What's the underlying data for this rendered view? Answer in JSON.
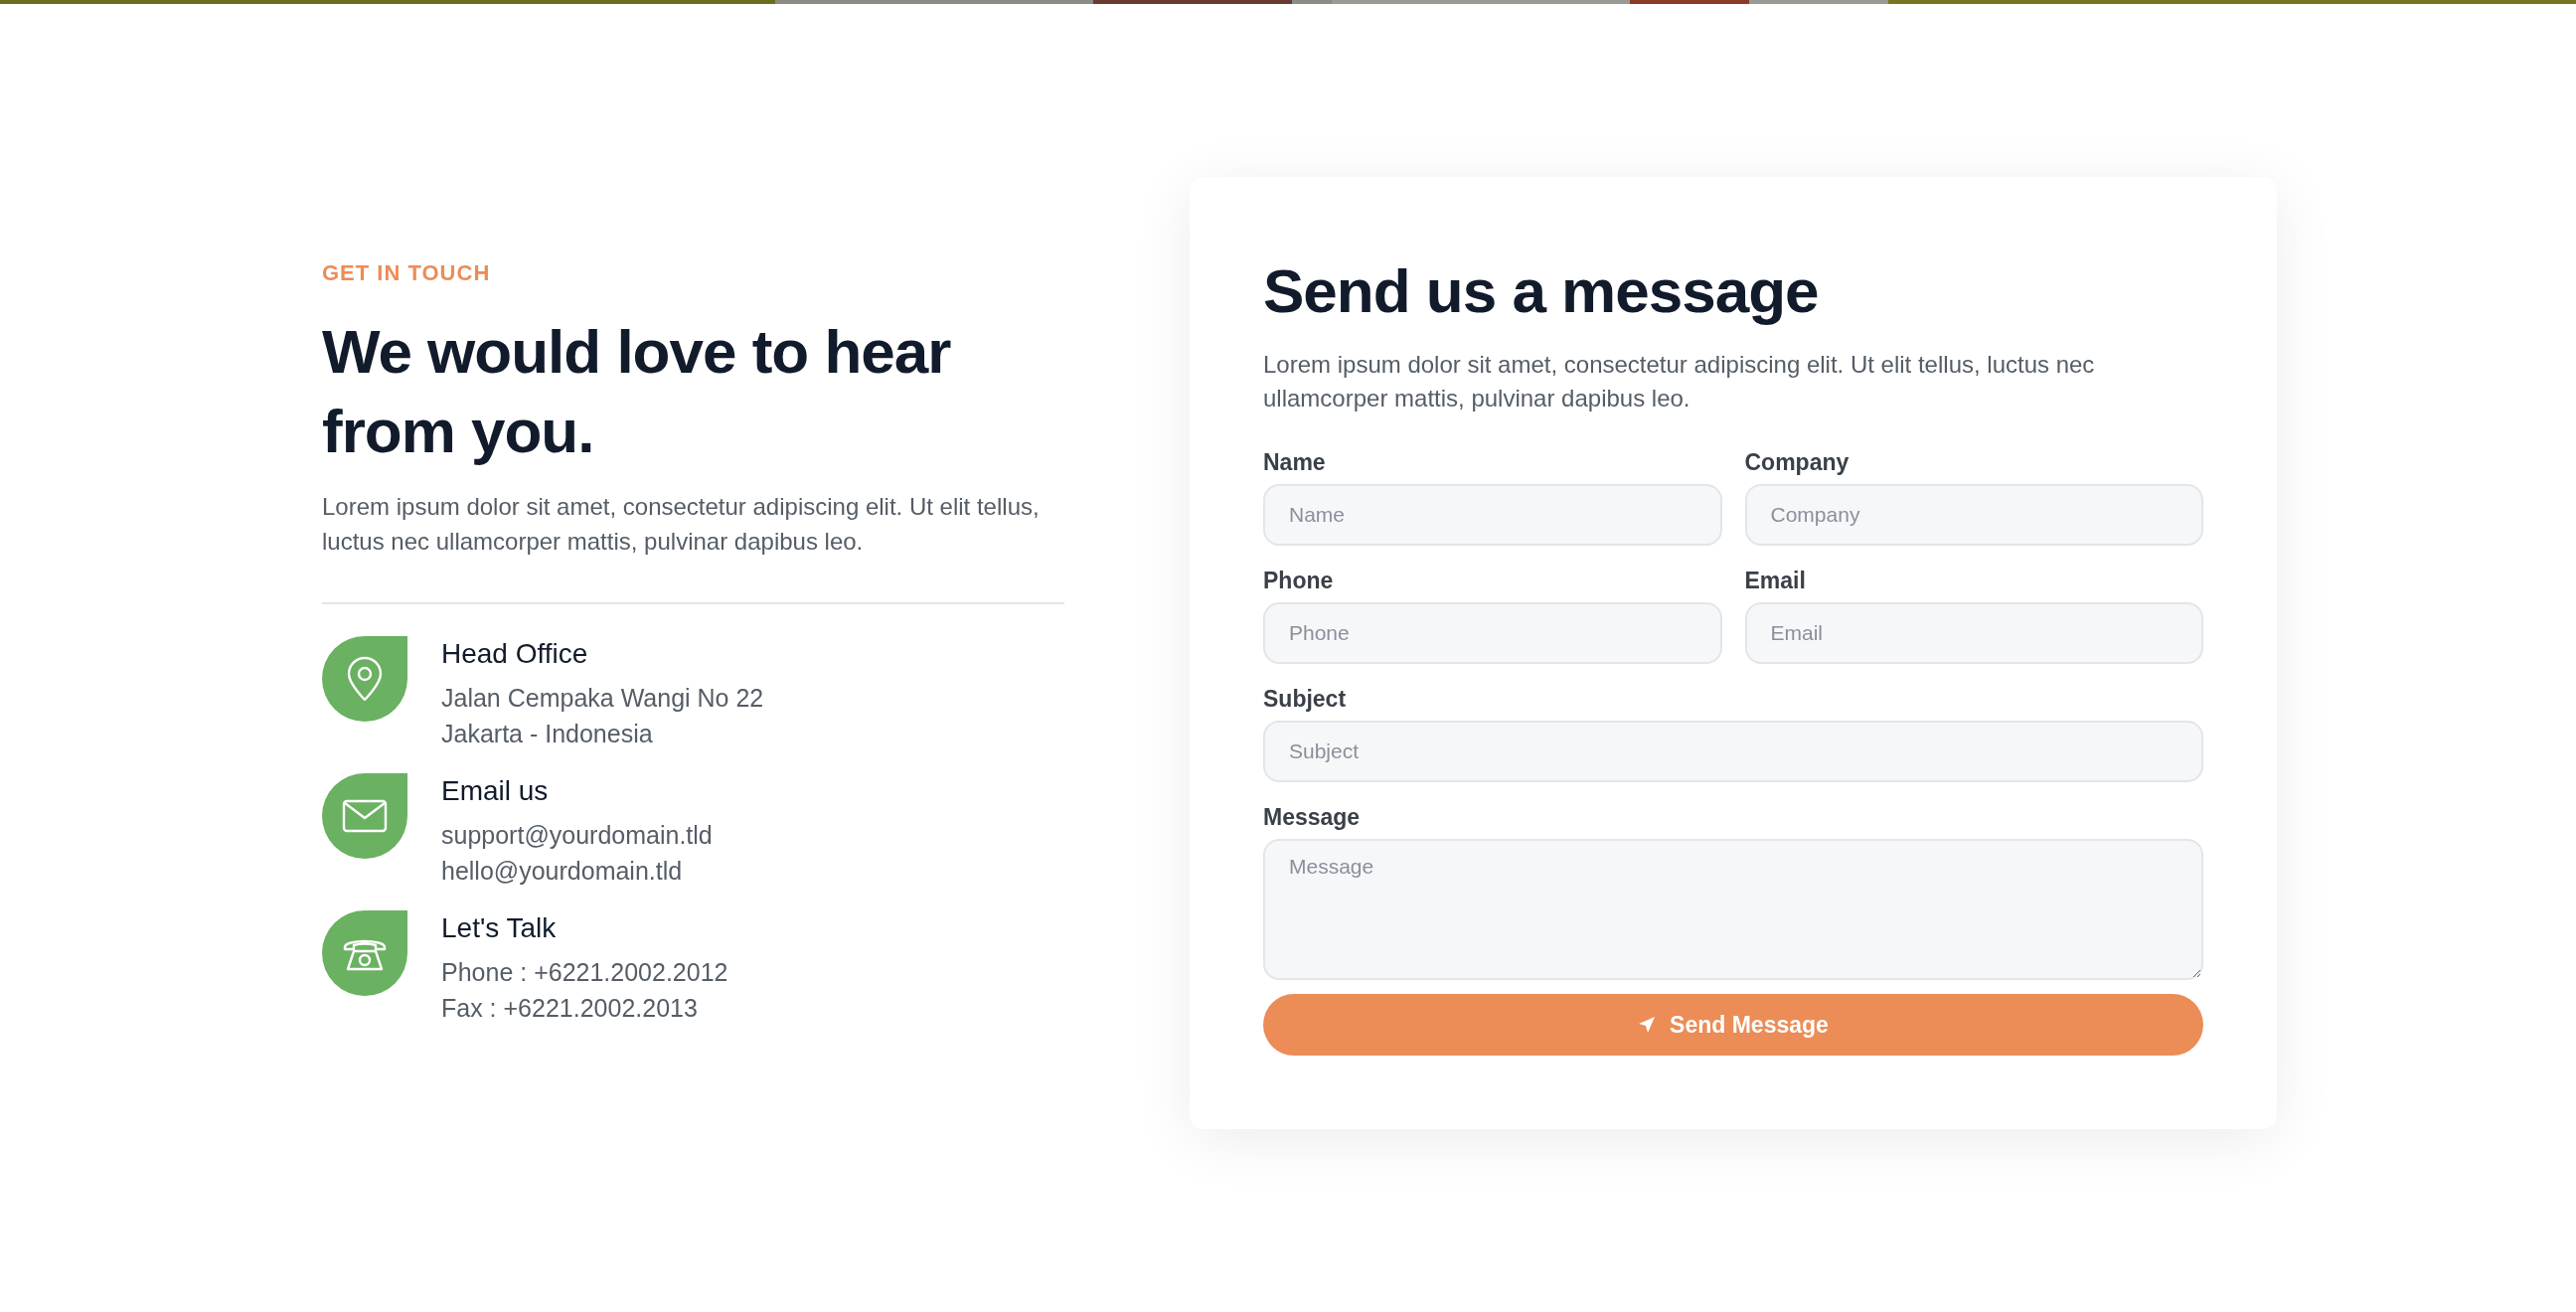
{
  "intro": {
    "eyebrow": "GET IN TOUCH",
    "heading_lines": [
      "We would love to hear",
      "from you."
    ],
    "text": "Lorem ipsum dolor sit amet, consectetur adipiscing elit. Ut elit tellus, luctus nec ullamcorper mattis, pulvinar dapibus leo."
  },
  "contacts": [
    {
      "kind": "location",
      "title": "Head Office",
      "lines": [
        "Jalan Cempaka Wangi No 22",
        "Jakarta - Indonesia"
      ]
    },
    {
      "kind": "email",
      "title": "Email us",
      "lines": [
        "support@yourdomain.tld",
        "hello@yourdomain.tld"
      ]
    },
    {
      "kind": "phone",
      "title": "Let's Talk",
      "lines": [
        "Phone : +6221.2002.2012",
        "Fax : +6221.2002.2013"
      ]
    }
  ],
  "form": {
    "title": "Send us a message",
    "text": "Lorem ipsum dolor sit amet, consectetur adipiscing elit. Ut elit tellus, luctus nec ullamcorper mattis, pulvinar dapibus leo.",
    "rows": [
      [
        {
          "kind": "input",
          "label": "Name",
          "placeholder": "Name"
        },
        {
          "kind": "input",
          "label": "Company",
          "placeholder": "Company"
        }
      ],
      [
        {
          "kind": "input",
          "label": "Phone",
          "placeholder": "Phone"
        },
        {
          "kind": "input",
          "label": "Email",
          "placeholder": "Email"
        }
      ],
      [
        {
          "kind": "input",
          "label": "Subject",
          "placeholder": "Subject"
        }
      ],
      [
        {
          "kind": "textarea",
          "label": "Message",
          "placeholder": "Message"
        }
      ]
    ],
    "button": "Send Message"
  }
}
